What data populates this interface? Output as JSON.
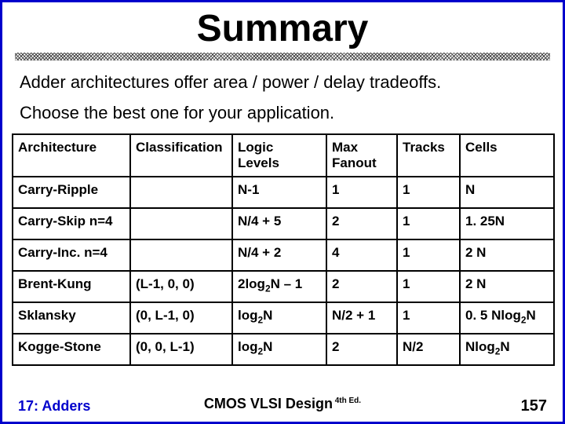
{
  "title": "Summary",
  "body": {
    "line1": "Adder architectures offer area / power / delay tradeoffs.",
    "line2": "Choose the best one for your application."
  },
  "table": {
    "headers": {
      "h1": "Architecture",
      "h2": "Classification",
      "h3_a": "Logic",
      "h3_b": "Levels",
      "h4_a": "Max",
      "h4_b": "Fanout",
      "h5": "Tracks",
      "h6": "Cells"
    },
    "rows": [
      {
        "arch": "Carry-Ripple",
        "cls": "",
        "logic": "N-1",
        "fanout": "1",
        "tracks": "1",
        "cells": "N"
      },
      {
        "arch": "Carry-Skip n=4",
        "cls": "",
        "logic": "N/4 + 5",
        "fanout": "2",
        "tracks": "1",
        "cells": "1. 25N"
      },
      {
        "arch": "Carry-Inc. n=4",
        "cls": "",
        "logic": "N/4 + 2",
        "fanout": "4",
        "tracks": "1",
        "cells": "2 N"
      },
      {
        "arch": "Brent-Kung",
        "cls": "(L-1, 0, 0)",
        "logic_html": "2log<sub>2</sub>N – 1",
        "fanout": "2",
        "tracks": "1",
        "cells": "2 N"
      },
      {
        "arch": "Sklansky",
        "cls": "(0, L-1, 0)",
        "logic_html": "log<sub>2</sub>N",
        "fanout": "N/2 + 1",
        "tracks": "1",
        "cells_html": "0. 5 Nlog<sub>2</sub>N"
      },
      {
        "arch": "Kogge-Stone",
        "cls": "(0, 0, L-1)",
        "logic_html": "log<sub>2</sub>N",
        "fanout": "2",
        "tracks": "N/2",
        "cells_html": "Nlog<sub>2</sub>N"
      }
    ]
  },
  "footer": {
    "left": "17: Adders",
    "center_main": "CMOS VLSI Design",
    "center_ed": " 4th Ed.",
    "right": "157"
  }
}
